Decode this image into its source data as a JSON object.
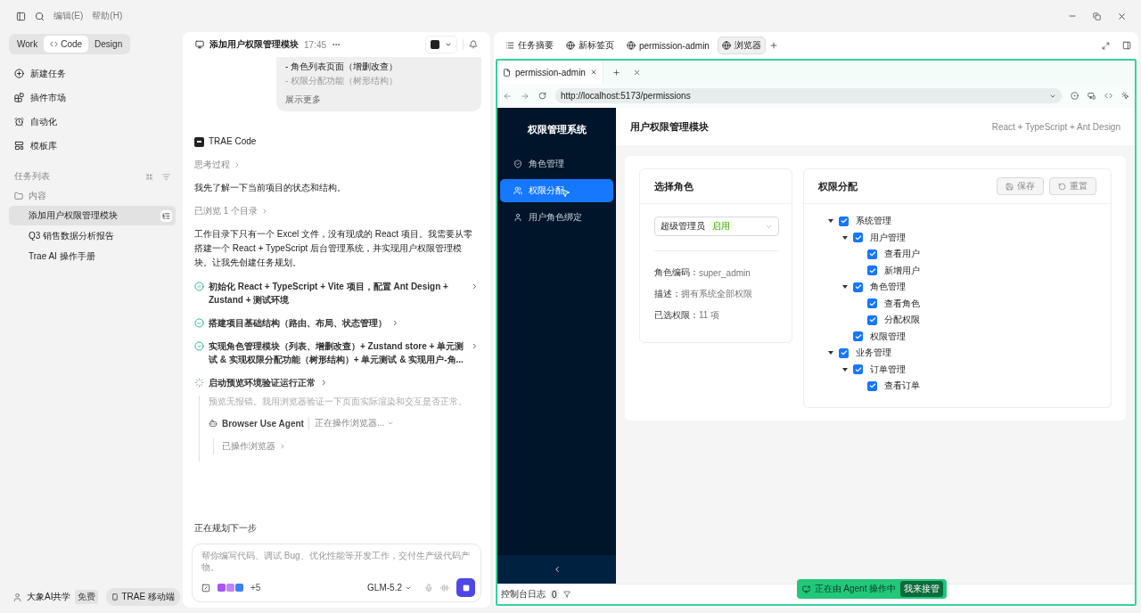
{
  "menu": [
    "编辑(E)",
    "帮助(H)"
  ],
  "modes": [
    {
      "label": "Work",
      "selected": false
    },
    {
      "label": "Code",
      "selected": true
    },
    {
      "label": "Design",
      "selected": false
    }
  ],
  "nav": [
    {
      "kind": "new",
      "label": "新建任务"
    },
    {
      "kind": "plugins",
      "label": "插件市场"
    },
    {
      "kind": "automation",
      "label": "自动化"
    },
    {
      "kind": "templates",
      "label": "模板库"
    }
  ],
  "task_list": {
    "title": "任务列表",
    "folder": "内容",
    "tasks": [
      {
        "label": "添加用户权限管理模块",
        "selected": true
      },
      {
        "label": "Q3 销售数据分析报告",
        "selected": false
      },
      {
        "label": "Trae AI 操作手册",
        "selected": false
      }
    ]
  },
  "account": {
    "name": "大象AI共学",
    "plan": "免费",
    "mobile": "TRAE 移动端"
  },
  "chat": {
    "title": "添加用户权限管理模块",
    "time": "17:45",
    "request_lines": [
      {
        "text": "- 角色列表页面（增删改查）",
        "faded": false
      },
      {
        "text": "- 权限分配功能（树形结构）",
        "faded": true
      }
    ],
    "show_more": "展示更多",
    "agent": "TRAE Code",
    "blocks": [
      {
        "kind": "collapsed",
        "text": "思考过程"
      },
      {
        "kind": "text",
        "text": "我先了解一下当前项目的状态和结构。"
      },
      {
        "kind": "collapsed",
        "text": "已浏览 1 个目录"
      },
      {
        "kind": "text",
        "text": "工作目录下只有一个 Excel 文件，没有现成的 React 项目。我需要从零搭建一个 React + TypeScript 后台管理系统，并实现用户权限管理模块。让我先创建任务规划。"
      }
    ],
    "steps": [
      {
        "done": true,
        "text": "初始化 React + TypeScript + Vite 项目，配置 Ant Design + Zustand + 测试环境"
      },
      {
        "done": true,
        "text": "搭建项目基础结构（路由、布局、状态管理）"
      },
      {
        "done": true,
        "text": "实现角色管理模块（列表、增删改查）+ Zustand store + 单元测试 & 实现权限分配功能（树形结构）+ 单元测试 & 实现用户-角..."
      },
      {
        "done": false,
        "text": "启动预览环境验证运行正常"
      }
    ],
    "running_note": "预览无报错。我用浏览器验证一下页面实际渲染和交互是否正常。",
    "tool": {
      "name": "Browser Use Agent",
      "status": "正在操作浏览器...",
      "result": "已操作浏览器"
    },
    "planning": "正在规划下一步",
    "input": {
      "placeholder": "帮你编写代码、调试 Bug、优化性能等开发工作，交付生产级代码产物。",
      "more_tools": "+5",
      "model": "GLM-5.2"
    }
  },
  "workspace": {
    "tabs": [
      {
        "kind": "list",
        "label": "任务摘要",
        "selected": false
      },
      {
        "kind": "web",
        "label": "新标签页",
        "selected": false
      },
      {
        "kind": "web",
        "label": "permission-admin",
        "selected": false
      },
      {
        "kind": "web",
        "label": "浏览器",
        "selected": true
      }
    ],
    "browser": {
      "tab": "permission-admin",
      "url": "http://localhost:5173/permissions",
      "app": {
        "brand": "权限管理系统",
        "menu": [
          {
            "kind": "role",
            "label": "角色管理",
            "selected": false
          },
          {
            "kind": "perm",
            "label": "权限分配",
            "selected": true
          },
          {
            "kind": "user",
            "label": "用户角色绑定",
            "selected": false
          }
        ],
        "title": "用户权限管理模块",
        "stack": "React + TypeScript + Ant Design",
        "role_card": {
          "title": "选择角色",
          "role": "超级管理员",
          "tag": "启用",
          "fields": [
            {
              "label": "角色编码：",
              "value": "super_admin"
            },
            {
              "label": "描述：",
              "value": "拥有系统全部权限"
            },
            {
              "label": "已选权限：",
              "value": "11 项"
            }
          ]
        },
        "perm_card": {
          "title": "权限分配",
          "actions": [
            {
              "kind": "save",
              "label": "保存",
              "disabled": true
            },
            {
              "kind": "reset",
              "label": "重置",
              "disabled": true
            }
          ],
          "tree": [
            {
              "label": "系统管理",
              "checked": true,
              "expanded": true,
              "children": [
                {
                  "label": "用户管理",
                  "checked": true,
                  "expanded": true,
                  "children": [
                    {
                      "label": "查看用户",
                      "checked": true
                    },
                    {
                      "label": "新增用户",
                      "checked": true
                    }
                  ]
                },
                {
                  "label": "角色管理",
                  "checked": true,
                  "expanded": true,
                  "children": [
                    {
                      "label": "查看角色",
                      "checked": true
                    },
                    {
                      "label": "分配权限",
                      "checked": true
                    }
                  ]
                },
                {
                  "label": "权限管理",
                  "checked": true
                }
              ]
            },
            {
              "label": "业务管理",
              "checked": true,
              "expanded": true,
              "children": [
                {
                  "label": "订单管理",
                  "checked": true,
                  "expanded": true,
                  "children": [
                    {
                      "label": "查看订单",
                      "checked": true
                    }
                  ]
                }
              ]
            }
          ]
        }
      },
      "console": {
        "label": "控制台日志",
        "count": "0"
      },
      "agent_banner": {
        "text": "正在由 Agent 操作中",
        "action": "我来接管"
      }
    }
  }
}
